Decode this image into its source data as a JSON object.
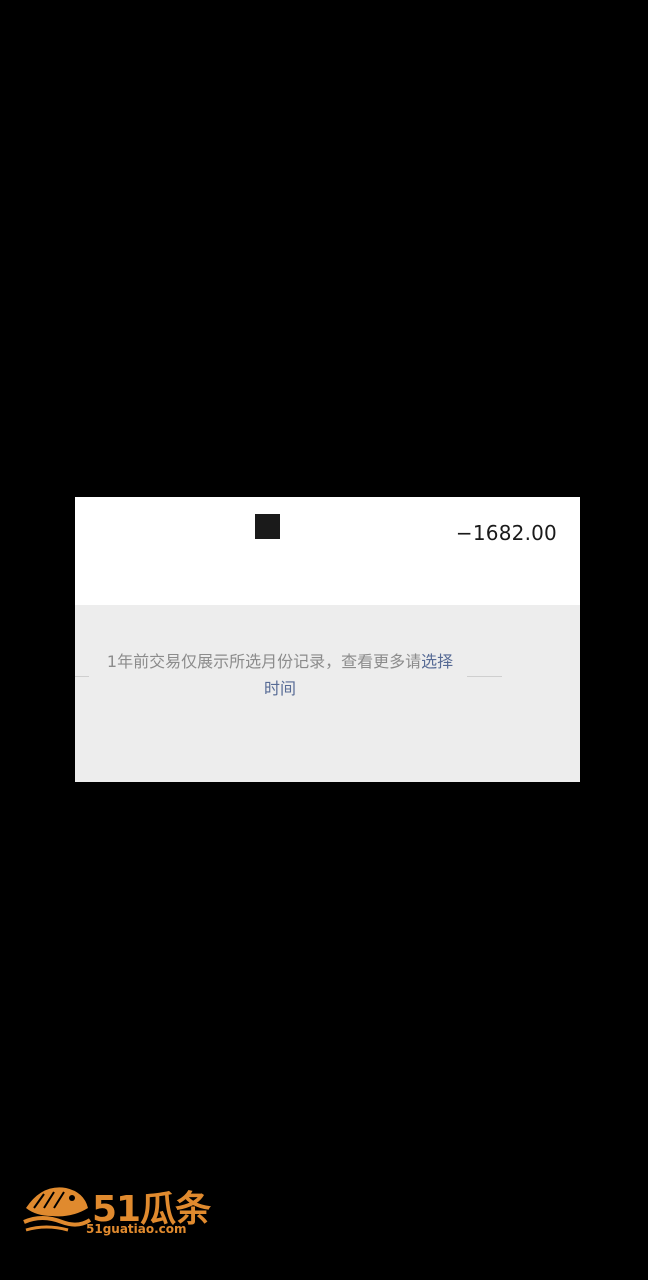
{
  "transaction": {
    "amount": "−1682.00"
  },
  "notice": {
    "text_before": "1年前交易仅展示所选月份记录，查看更多请",
    "link_label": "选择时间"
  },
  "watermark": {
    "logo_text": "51瓜条",
    "site": "51guatiao.com",
    "icon": "fish-logo-icon",
    "color": "#e08a2e"
  },
  "colors": {
    "background": "#000000",
    "card": "#ededed",
    "row": "#ffffff",
    "link": "#576b95",
    "muted_text": "#8c8c8c"
  }
}
